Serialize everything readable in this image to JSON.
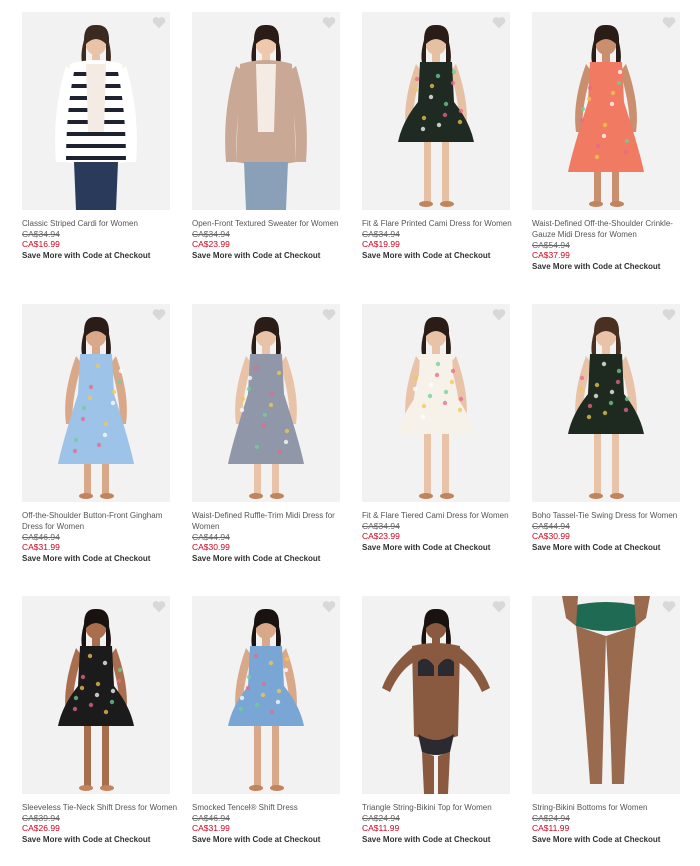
{
  "products": [
    {
      "name": "Classic Striped Cardi for Women",
      "was": "CA$34.94",
      "now": "CA$16.99",
      "promo": "Save More with Code at Checkout",
      "icon": "cardigan-model-image"
    },
    {
      "name": "Open-Front Textured Sweater for Women",
      "was": "CA$34.94",
      "now": "CA$23.99",
      "promo": "Save More with Code at Checkout",
      "icon": "sweater-model-image"
    },
    {
      "name": "Fit & Flare Printed Cami Dress for Women",
      "was": "CA$34.94",
      "now": "CA$19.99",
      "promo": "Save More with Code at Checkout",
      "icon": "dress-model-image"
    },
    {
      "name": "Waist-Defined Off-the-Shoulder Crinkle-Gauze Midi Dress for Women",
      "was": "CA$54.94",
      "now": "CA$37.99",
      "promo": "Save More with Code at Checkout",
      "icon": "dress-model-image"
    },
    {
      "name": "Off-the-Shoulder Button-Front Gingham Dress for Women",
      "was": "CA$46.94",
      "now": "CA$31.99",
      "promo": "Save More with Code at Checkout",
      "icon": "dress-model-image"
    },
    {
      "name": "Waist-Defined Ruffle-Trim Midi Dress for Women",
      "was": "CA$44.94",
      "now": "CA$30.99",
      "promo": "Save More with Code at Checkout",
      "icon": "dress-model-image"
    },
    {
      "name": "Fit & Flare Tiered Cami Dress for Women",
      "was": "CA$34.94",
      "now": "CA$23.99",
      "promo": "Save More with Code at Checkout",
      "icon": "dress-model-image"
    },
    {
      "name": "Boho Tassel-Tie Swing Dress for Women",
      "was": "CA$44.94",
      "now": "CA$30.99",
      "promo": "Save More with Code at Checkout",
      "icon": "dress-model-image"
    },
    {
      "name": "Sleeveless Tie-Neck Shift Dress for Women",
      "was": "CA$39.94",
      "now": "CA$26.99",
      "promo": "Save More with Code at Checkout",
      "icon": "dress-model-image"
    },
    {
      "name": "Smocked Tencel® Shift Dress",
      "was": "CA$46.94",
      "now": "CA$31.99",
      "promo": "Save More with Code at Checkout",
      "icon": "dress-model-image"
    },
    {
      "name": "Triangle String-Bikini Top for Women",
      "was": "CA$24.94",
      "now": "CA$11.99",
      "promo": "Save More with Code at Checkout",
      "icon": "bikini-top-model-image"
    },
    {
      "name": "String-Bikini Bottoms for Women",
      "was": "CA$24.94",
      "now": "CA$11.99",
      "promo": "Save More with Code at Checkout",
      "icon": "bikini-bottoms-model-image"
    }
  ],
  "colors": {
    "was_price": "#666666",
    "sale_price": "#d0021b",
    "photo_background": "#f2f2f2",
    "favorite_icon": "#d8d8d8"
  }
}
